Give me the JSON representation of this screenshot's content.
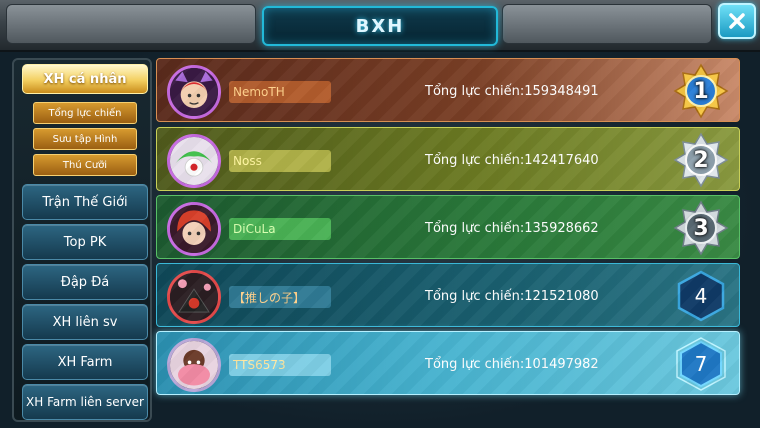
{
  "header": {
    "title": "BXH",
    "close_icon": "close-x-icon"
  },
  "sidebar": {
    "items": [
      {
        "label": "XH cá nhân",
        "active": true
      },
      {
        "label": "Tổng lực chiến",
        "sub": true
      },
      {
        "label": "Sưu tập Hình",
        "sub": true
      },
      {
        "label": "Thú Cưỡi",
        "sub": true
      },
      {
        "label": "Trận Thế Giới"
      },
      {
        "label": "Top PK"
      },
      {
        "label": "Đập Đá"
      },
      {
        "label": "XH liên sv"
      },
      {
        "label": "XH Farm"
      },
      {
        "label": "XH Farm liên server"
      }
    ]
  },
  "ranking": {
    "rows": [
      {
        "name": "NemoTH",
        "power": "Tổng lực chiến:159348491",
        "rank": "1",
        "medal": "gold"
      },
      {
        "name": "Noss",
        "power": "Tổng lực chiến:142417640",
        "rank": "2",
        "medal": "silver"
      },
      {
        "name": "DiCuLa",
        "power": "Tổng lực chiến:135928662",
        "rank": "3",
        "medal": "bronze-silver"
      },
      {
        "name": "【推しの子】",
        "power": "Tổng lực chiến:121521080",
        "rank": "4",
        "medal": "hexagon"
      },
      {
        "name": "TTS6573",
        "power": "Tổng lực chiến:101497982",
        "rank": "7",
        "medal": "hexagon-glow"
      }
    ]
  },
  "colors": {
    "accent": "#22b9d8",
    "gold": "#f3cf60",
    "row1": "#7a3f25",
    "row2": "#6b7a22",
    "row3": "#2a7a3a",
    "row4": "#1a6070",
    "row5": "#48b4d0"
  }
}
